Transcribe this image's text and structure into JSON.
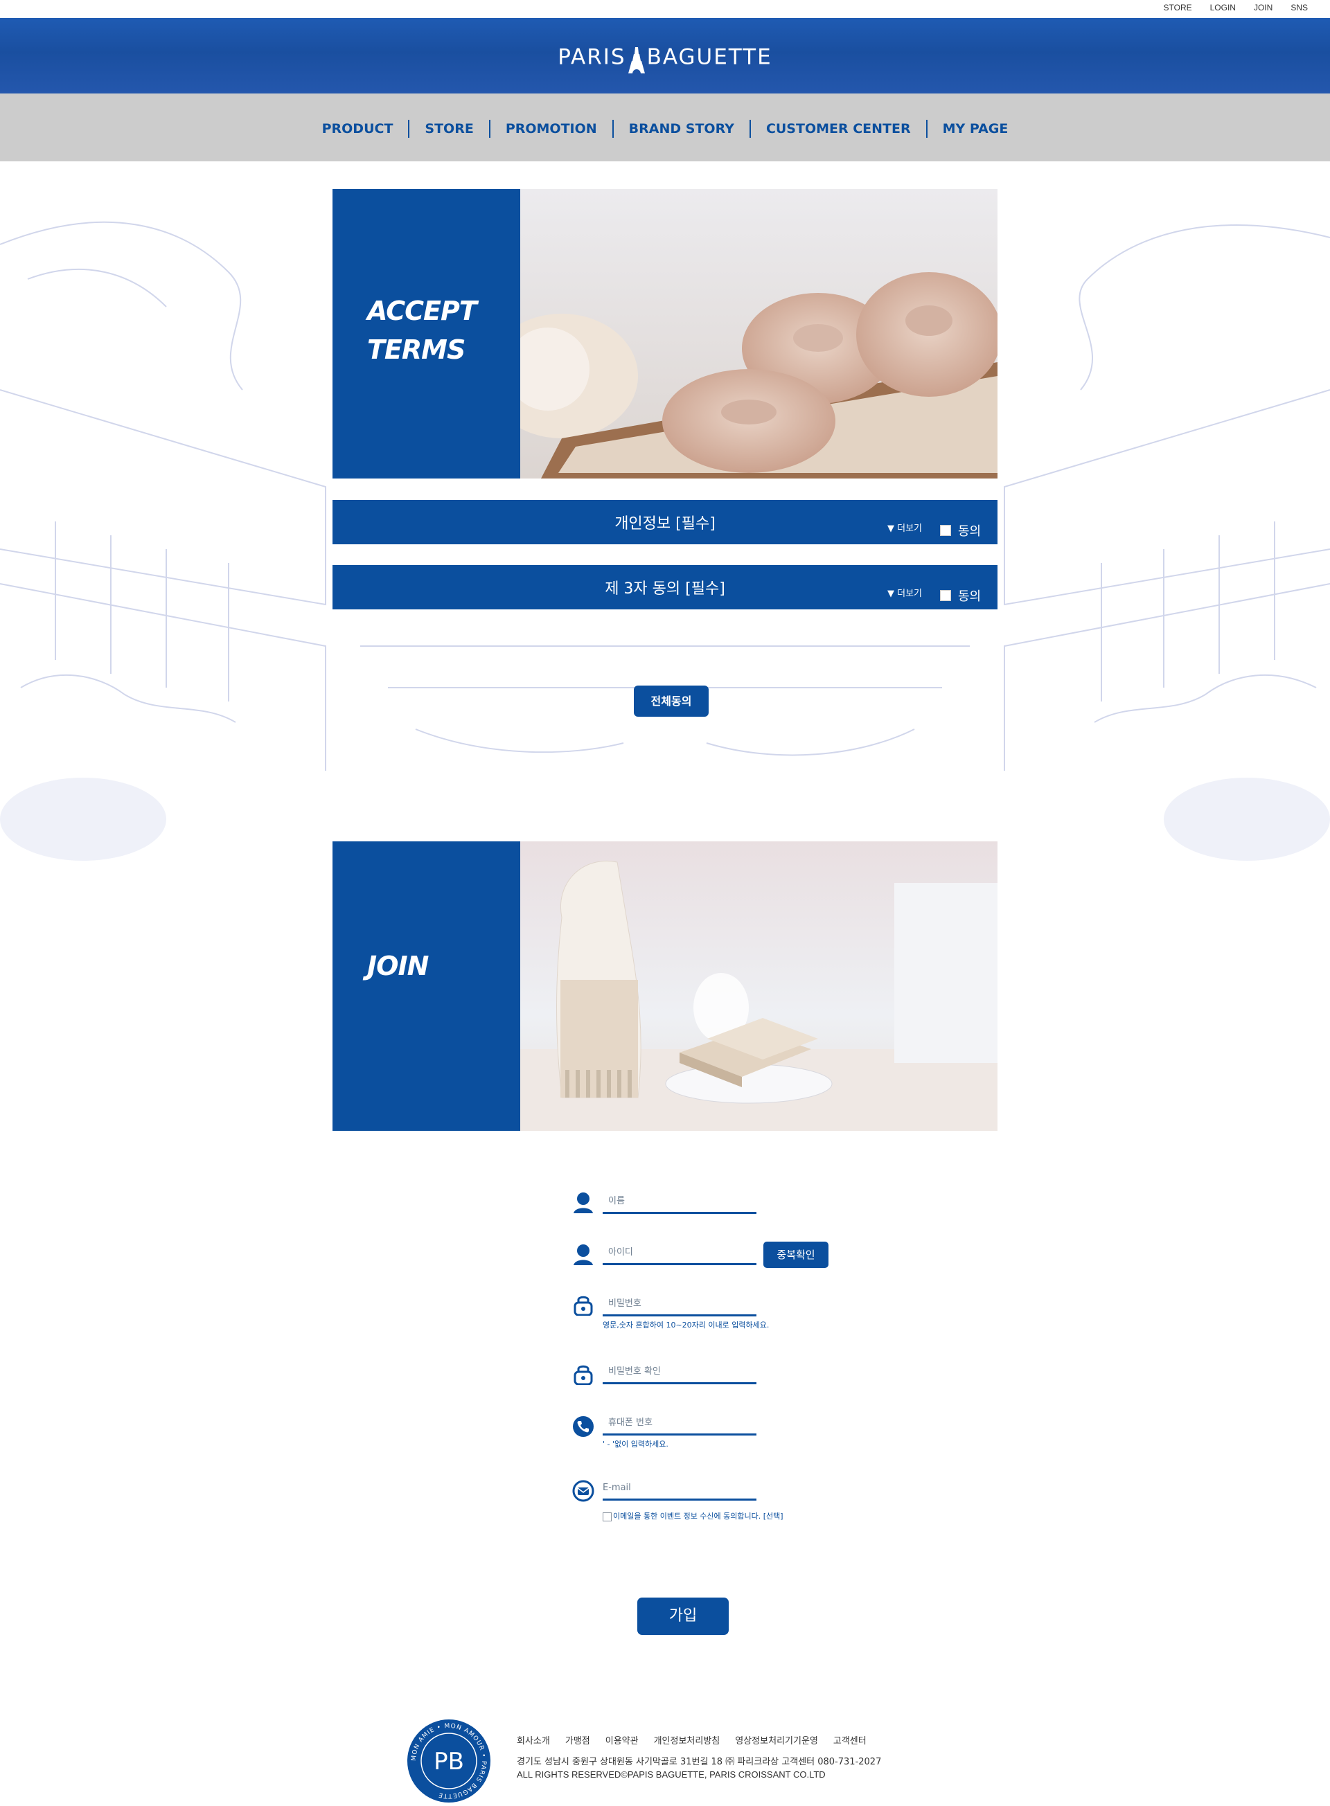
{
  "util_links": [
    "STORE",
    "LOGIN",
    "JOIN",
    "SNS"
  ],
  "logo": {
    "left": "PARIS",
    "right": "BAGUETTE"
  },
  "nav": [
    "PRODUCT",
    "STORE",
    "PROMOTION",
    "BRAND STORY",
    "CUSTOMER CENTER",
    "MY PAGE"
  ],
  "accept_banner": {
    "line1": "ACCEPT",
    "line2": "TERMS"
  },
  "terms": [
    {
      "label": "개인정보 [필수]",
      "more": "▼ 더보기",
      "agree": "동의"
    },
    {
      "label": "제 3자 동의 [필수]",
      "more": "▼ 더보기",
      "agree": "동의"
    }
  ],
  "agree_all": "전체동의",
  "join_banner": {
    "title": "JOIN"
  },
  "form": {
    "name": "이름",
    "id": "아이디",
    "dup_check": "중복확인",
    "password": "비밀번호",
    "password_hint": "영문,숫자 혼합하여 10~20자리 이내로 입력하세요.",
    "password_confirm": "비밀번호 확인",
    "phone": "휴대폰 번호",
    "phone_hint": "' - '없이 입력하세요.",
    "email": "E-mail",
    "email_opt": "이메일을 통한 이벤트 정보 수신에 동의합니다. [선택]",
    "submit": "가입"
  },
  "footer": {
    "links": [
      "회사소개",
      "가맹점",
      "이용약관",
      "개인정보처리방침",
      "영상정보처리기기운영",
      "고객센터"
    ],
    "address": "경기도 성남시 중원구 상대원동 사기막골로 31번길 18 ㈜ 파리크라상 고객센터 080-731-2027",
    "copyright": "ALL RIGHTS RESERVED©PAPIS BAGUETTE, PARIS CROISSANT CO.LTD",
    "badge_text": "MON AMIE • MON AMOUR • PARIS BAGUETTE",
    "badge_mark": "PB"
  },
  "colors": {
    "brand_blue": "#0b4f9e",
    "nav_gray": "#cccccc"
  }
}
